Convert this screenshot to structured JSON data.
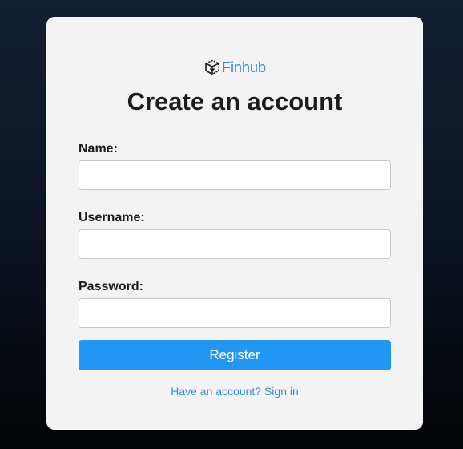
{
  "brand": {
    "name": "Finhub",
    "icon": "cube-icon"
  },
  "form": {
    "title": "Create an account",
    "fields": [
      {
        "label": "Name:",
        "value": "",
        "placeholder": ""
      },
      {
        "label": "Username:",
        "value": "",
        "placeholder": ""
      },
      {
        "label": "Password:",
        "value": "",
        "placeholder": ""
      }
    ],
    "submit_label": "Register",
    "signin_link": "Have an account? Sign in"
  },
  "colors": {
    "accent": "#2196f3",
    "link": "#2d8fe0",
    "card": "#f3f3f3"
  }
}
